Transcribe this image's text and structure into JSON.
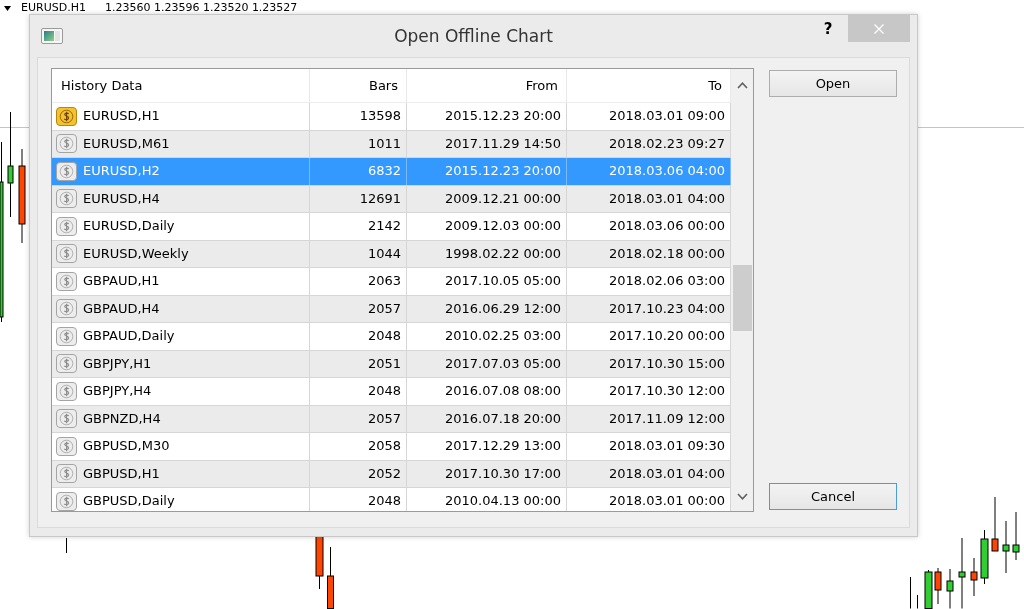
{
  "chart": {
    "symbol": "EURUSD.H1",
    "quotes": "1.23560 1.23596 1.23520 1.23527"
  },
  "dialog": {
    "title": "Open Offline Chart",
    "help_button": "?",
    "table": {
      "columns": [
        "History Data",
        "Bars",
        "From",
        "To"
      ],
      "rows": [
        {
          "symbol": "EURUSD,H1",
          "bars": "13598",
          "from": "2015.12.23 20:00",
          "to": "2018.03.01 09:00",
          "active": true,
          "selected": false
        },
        {
          "symbol": "EURUSD,M61",
          "bars": "1011",
          "from": "2017.11.29 14:50",
          "to": "2018.02.23 09:27",
          "active": false,
          "selected": false
        },
        {
          "symbol": "EURUSD,H2",
          "bars": "6832",
          "from": "2015.12.23 20:00",
          "to": "2018.03.06 04:00",
          "active": false,
          "selected": true
        },
        {
          "symbol": "EURUSD,H4",
          "bars": "12691",
          "from": "2009.12.21 00:00",
          "to": "2018.03.01 04:00",
          "active": false,
          "selected": false
        },
        {
          "symbol": "EURUSD,Daily",
          "bars": "2142",
          "from": "2009.12.03 00:00",
          "to": "2018.03.06 00:00",
          "active": false,
          "selected": false
        },
        {
          "symbol": "EURUSD,Weekly",
          "bars": "1044",
          "from": "1998.02.22 00:00",
          "to": "2018.02.18 00:00",
          "active": false,
          "selected": false
        },
        {
          "symbol": "GBPAUD,H1",
          "bars": "2063",
          "from": "2017.10.05 05:00",
          "to": "2018.02.06 03:00",
          "active": false,
          "selected": false
        },
        {
          "symbol": "GBPAUD,H4",
          "bars": "2057",
          "from": "2016.06.29 12:00",
          "to": "2017.10.23 04:00",
          "active": false,
          "selected": false
        },
        {
          "symbol": "GBPAUD,Daily",
          "bars": "2048",
          "from": "2010.02.25 03:00",
          "to": "2017.10.20 00:00",
          "active": false,
          "selected": false
        },
        {
          "symbol": "GBPJPY,H1",
          "bars": "2051",
          "from": "2017.07.03 05:00",
          "to": "2017.10.30 15:00",
          "active": false,
          "selected": false
        },
        {
          "symbol": "GBPJPY,H4",
          "bars": "2048",
          "from": "2016.07.08 08:00",
          "to": "2017.10.30 12:00",
          "active": false,
          "selected": false
        },
        {
          "symbol": "GBPNZD,H4",
          "bars": "2057",
          "from": "2016.07.18 20:00",
          "to": "2017.11.09 12:00",
          "active": false,
          "selected": false
        },
        {
          "symbol": "GBPUSD,M30",
          "bars": "2058",
          "from": "2017.12.29 13:00",
          "to": "2018.03.01 09:30",
          "active": false,
          "selected": false
        },
        {
          "symbol": "GBPUSD,H1",
          "bars": "2052",
          "from": "2017.10.30 17:00",
          "to": "2018.03.01 04:00",
          "active": false,
          "selected": false
        },
        {
          "symbol": "GBPUSD,Daily",
          "bars": "2048",
          "from": "2010.04.13 00:00",
          "to": "2018.03.01 00:00",
          "active": false,
          "selected": false
        }
      ]
    },
    "buttons": [
      {
        "label": "Open",
        "focused": false
      },
      {
        "label": "Cancel",
        "focused": true
      }
    ]
  }
}
